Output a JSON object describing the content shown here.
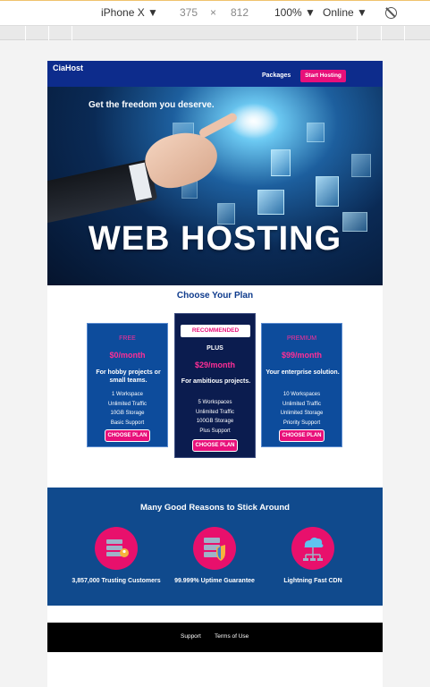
{
  "devtools": {
    "device": "iPhone X ▼",
    "width": "375",
    "times": "×",
    "height": "812",
    "zoom": "100% ▼",
    "network": "Online ▼"
  },
  "site": {
    "logo": "CiaHost",
    "nav": {
      "packages": "Packages",
      "cta": "Start Hosting"
    },
    "hero": {
      "tagline": "Get the freedom you deserve.",
      "title": "WEB HOSTING"
    },
    "plans_title": "Choose Your Plan",
    "plans": [
      {
        "name": "FREE",
        "price": "$0/month",
        "desc": "For hobby projects or small teams.",
        "features": [
          "1 Workspace",
          "Unlimited Traffic",
          "10GB Storage",
          "Basic Support"
        ],
        "button": "CHOOSE PLAN"
      },
      {
        "badge": "RECOMMENDED",
        "name": "PLUS",
        "price": "$29/month",
        "desc": "For ambitious projects.",
        "features": [
          "5 Workspaces",
          "Unlimited Traffic",
          "100GB Storage",
          "Plus Support"
        ],
        "button": "CHOOSE PLAN"
      },
      {
        "name": "PREMIUM",
        "price": "$99/month",
        "desc": "Your enterprise solution.",
        "features": [
          "10 Workspaces",
          "Unlimited Traffic",
          "Unlimited Storage",
          "Priority Support"
        ],
        "button": "CHOOSE PLAN"
      }
    ],
    "reasons_title": "Many Good Reasons to Stick Around",
    "reasons": [
      {
        "icon": "server-customer-icon",
        "label": "3,857,000 Trusting Customers"
      },
      {
        "icon": "shield-server-icon",
        "label": "99.999% Uptime Guarantee"
      },
      {
        "icon": "cloud-network-icon",
        "label": "Lightning Fast CDN"
      }
    ],
    "footer": {
      "support": "Support",
      "terms": "Terms of Use"
    }
  },
  "colors": {
    "nav": "#0d2c8c",
    "accent": "#e8107a",
    "plan": "#0d4c9c",
    "plan_featured": "#0b1c4f",
    "reasons_bg": "#104a8d",
    "footer": "#000000"
  }
}
